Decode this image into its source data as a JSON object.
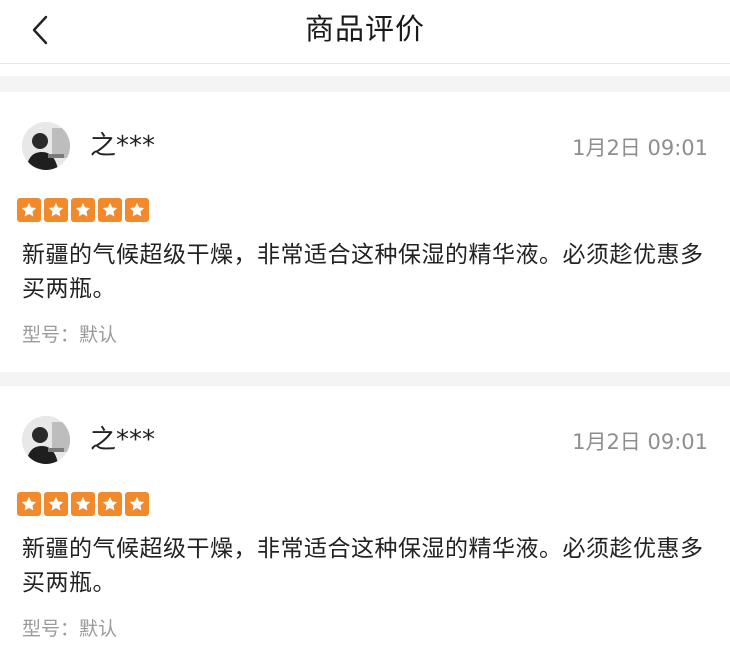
{
  "header": {
    "title": "商品评价",
    "back_icon": "chevron-left-icon"
  },
  "colors": {
    "star": "#f28a2c",
    "gap": "#f4f4f4",
    "secondary_text": "#8e8e8e"
  },
  "reviews": [
    {
      "user": "之***",
      "time": "1月2日 09:01",
      "rating": 5,
      "content": "新疆的气候超级干燥，非常适合这种保湿的精华液。必须趁优惠多买两瓶。",
      "spec": "型号：默认"
    },
    {
      "user": "之***",
      "time": "1月2日 09:01",
      "rating": 5,
      "content": "新疆的气候超级干燥，非常适合这种保湿的精华液。必须趁优惠多买两瓶。",
      "spec": "型号：默认"
    }
  ]
}
